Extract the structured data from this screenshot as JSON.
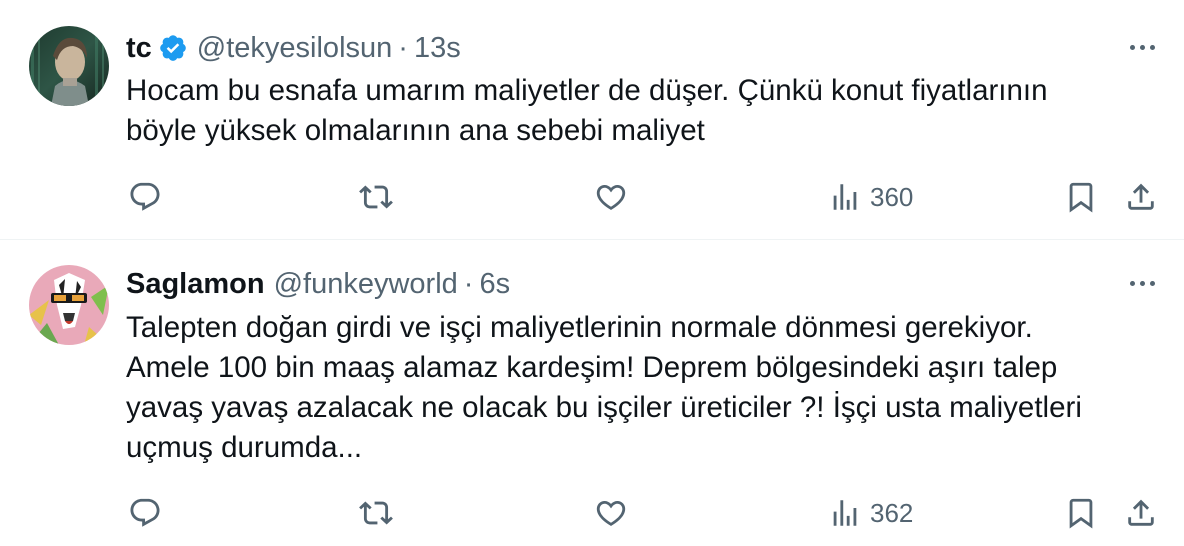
{
  "tweets": [
    {
      "name": "tc",
      "verified": true,
      "handle": "@tekyesilolsun",
      "separator": "·",
      "time": "13s",
      "lines": [
        "Hocam bu esnafa umarım maliyetler de düşer. Çünkü konut fiyatlarının",
        "böyle yüksek olmalarının ana sebebi maliyet"
      ],
      "views": "360"
    },
    {
      "name": "Saglamon",
      "verified": false,
      "handle": "@funkeyworld",
      "separator": "·",
      "time": "6s",
      "lines": [
        "Talepten doğan girdi ve işçi maliyetlerinin normale dönmesi gerekiyor.",
        "Amele 100 bin maaş alamaz kardeşim! Deprem bölgesindeki aşırı talep",
        "yavaş yavaş azalacak ne olacak bu işçiler üreticiler ?! İşçi usta maliyetleri",
        "uçmuş durumda..."
      ],
      "views": "362"
    }
  ],
  "colors": {
    "text": "#0f1419",
    "secondary": "#536471",
    "verified": "#1d9bf0",
    "divider": "#eff3f4"
  },
  "icons": [
    "reply-icon",
    "retweet-icon",
    "like-icon",
    "views-icon",
    "bookmark-icon",
    "share-icon",
    "more-icon",
    "verified-badge-icon"
  ]
}
